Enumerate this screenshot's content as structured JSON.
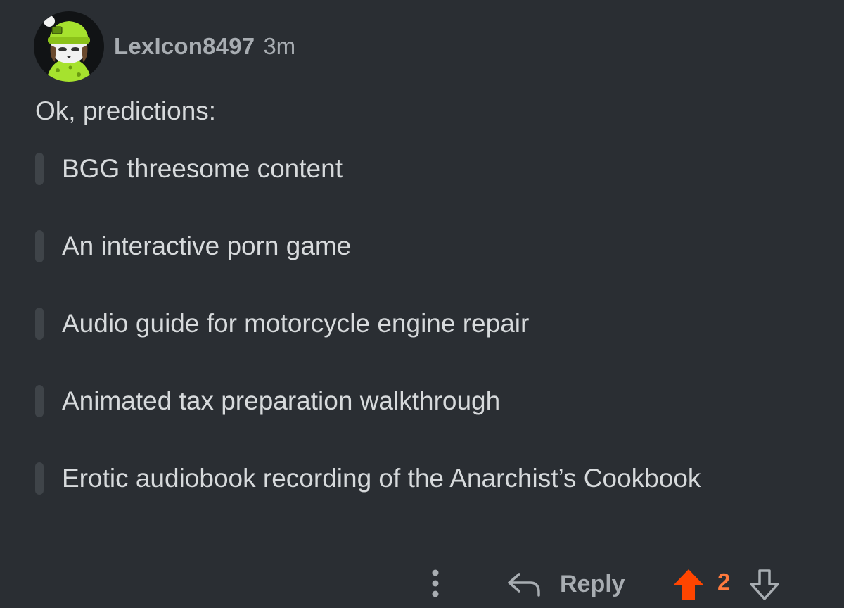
{
  "comment": {
    "username": "LexIcon8497",
    "timestamp": "3m",
    "intro": "Ok, predictions:",
    "quotes": [
      "BGG threesome content",
      "An interactive porn game",
      "Audio guide for motorcycle engine repair",
      "Animated tax preparation walkthrough",
      "Erotic audiobook recording of the Anarchist’s Cookbook"
    ]
  },
  "actions": {
    "more_icon": "more-vertical-icon",
    "reply_icon": "reply-arrow-icon",
    "reply_label": "Reply",
    "upvote_icon": "upvote-arrow-icon",
    "upvote_state": "active",
    "score": "2",
    "downvote_icon": "downvote-arrow-icon"
  },
  "colors": {
    "background": "#2a2e33",
    "text": "#d7dadc",
    "meta": "#a8adb2",
    "upvote": "#ff4500",
    "score": "#ff7a3d",
    "quote_bar": "#3f4449",
    "avatar_beanie": "#a6e22e"
  }
}
